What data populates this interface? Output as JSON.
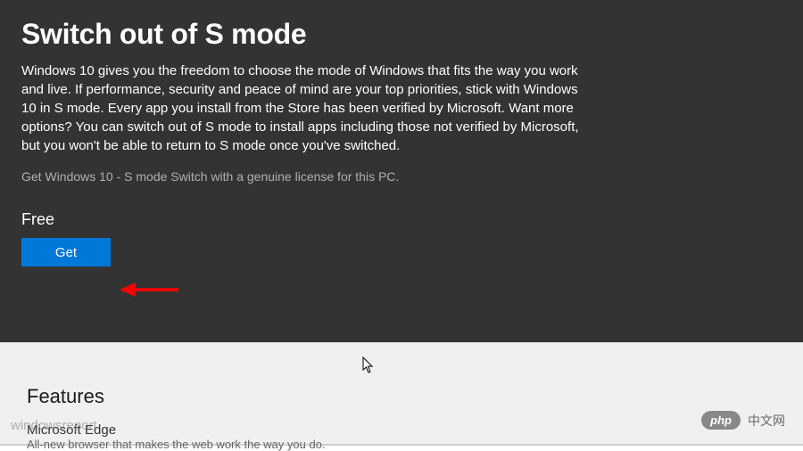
{
  "top": {
    "title": "Switch out of S mode",
    "description": "Windows 10 gives you the freedom to choose the mode of Windows that fits the way you work and live. If performance, security and peace of mind are your top priorities, stick with Windows 10 in S mode.  Every app you install from the Store has been verified by Microsoft. Want more options? You can switch out of S mode to install apps including those not verified by Microsoft, but you won't be able to return to S mode once you've switched.",
    "license_note": "Get Windows 10 - S mode Switch with a genuine license for this PC.",
    "price_label": "Free",
    "get_button": "Get"
  },
  "bottom": {
    "features_heading": "Features",
    "feature_name": "Microsoft Edge",
    "feature_desc": "All-new browser that makes the web work the way you do."
  },
  "badges": {
    "php": "php",
    "right_text": "中文网",
    "left_watermark": "windowsreport"
  }
}
